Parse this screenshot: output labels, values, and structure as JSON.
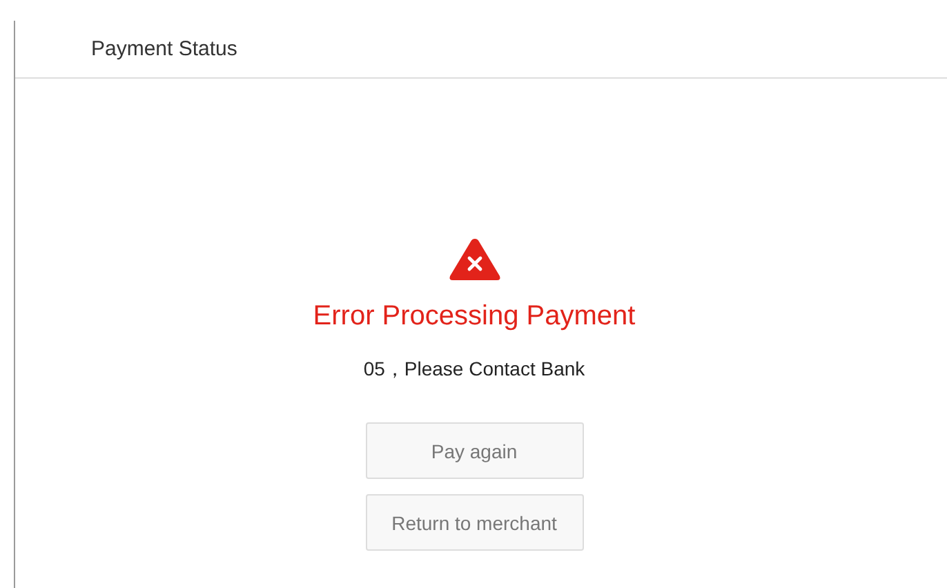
{
  "header": {
    "title": "Payment Status"
  },
  "status": {
    "kind": "error",
    "title": "Error Processing Payment",
    "message": "05，Please Contact Bank"
  },
  "buttons": [
    "Pay again",
    "Return to merchant"
  ]
}
